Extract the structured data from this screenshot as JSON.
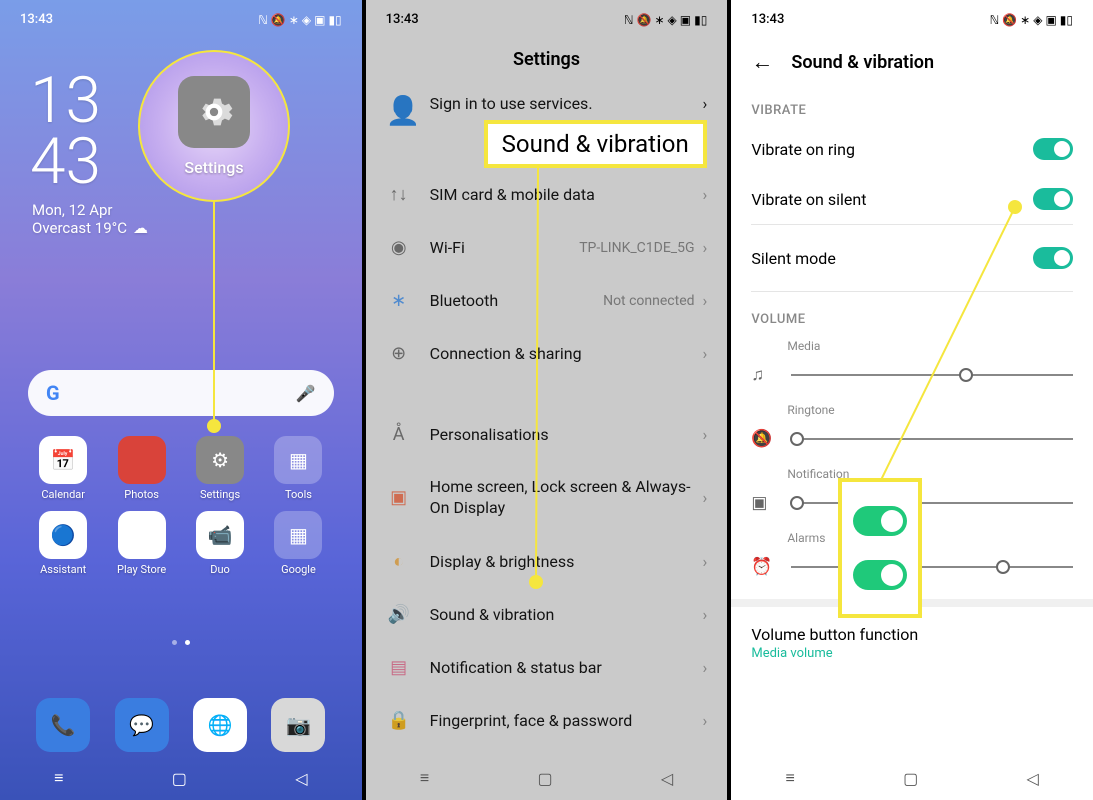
{
  "status": {
    "time": "13:43"
  },
  "screen1": {
    "clock1": "13",
    "clock2": "43",
    "date": "Mon, 12 Apr",
    "weather": "Overcast 19°C",
    "callout_label": "Settings",
    "apps": {
      "calendar": "Calendar",
      "photos": "Photos",
      "settings": "Settings",
      "tools": "Tools",
      "assistant": "Assistant",
      "playstore": "Play Store",
      "duo": "Duo",
      "google": "Google"
    }
  },
  "screen2": {
    "title": "Settings",
    "signin_sub": "Sign in to use services.",
    "callout": "Sound & vibration",
    "rows": {
      "sim": "SIM card & mobile data",
      "wifi": "Wi-Fi",
      "wifi_val": "TP-LINK_C1DE_5G",
      "bluetooth": "Bluetooth",
      "bt_val": "Not connected",
      "connection": "Connection & sharing",
      "personal": "Personalisations",
      "homescreen": "Home screen, Lock screen & Always-On Display",
      "display": "Display & brightness",
      "sound": "Sound & vibration",
      "notification": "Notification & status bar",
      "fingerprint": "Fingerprint, face & password"
    }
  },
  "screen3": {
    "title": "Sound & vibration",
    "section_vibrate": "VIBRATE",
    "vibrate_ring": "Vibrate on ring",
    "vibrate_silent": "Vibrate on silent",
    "silent_mode": "Silent mode",
    "section_volume": "VOLUME",
    "media": "Media",
    "ringtone": "Ringtone",
    "notification": "Notification",
    "alarms": "Alarms",
    "volbtn": "Volume button function",
    "volsub": "Media volume",
    "sliders": {
      "media": 62,
      "ringtone": 2,
      "notification": 2,
      "alarms": 75
    }
  }
}
